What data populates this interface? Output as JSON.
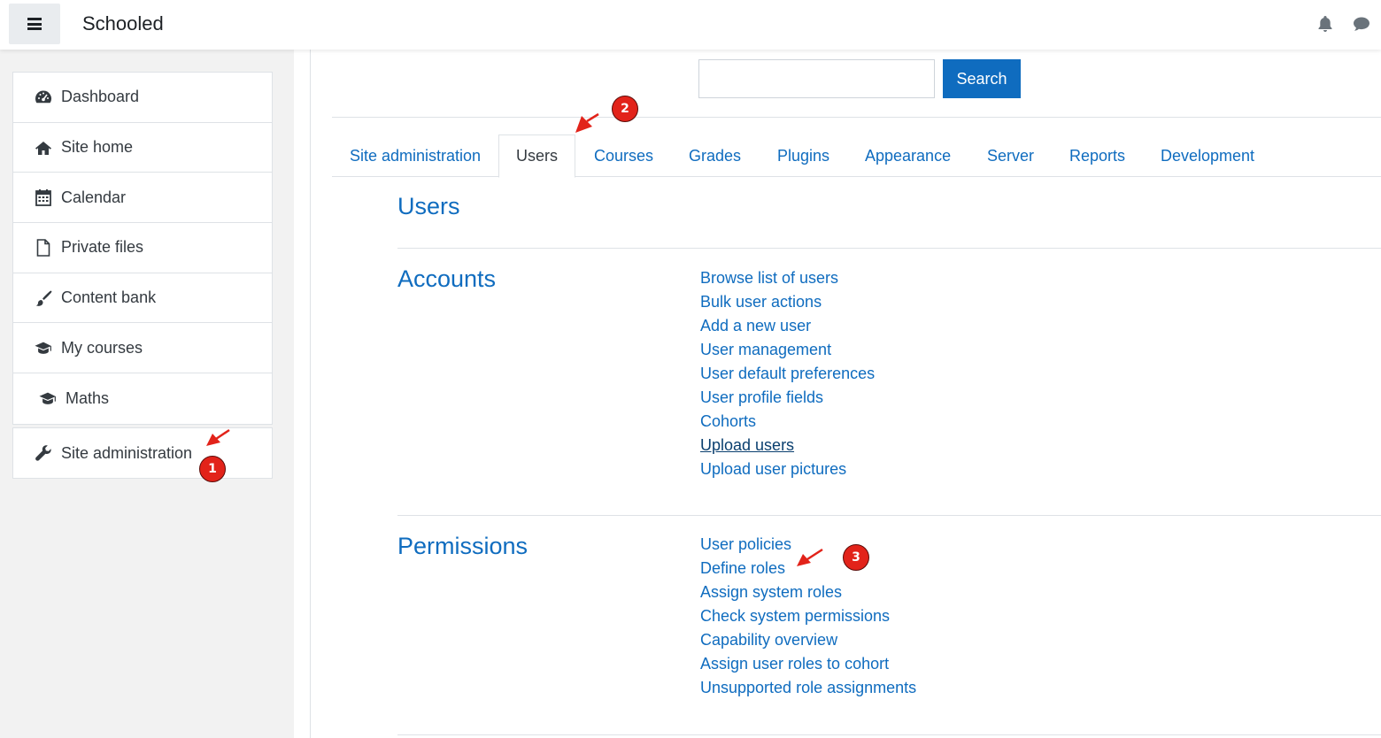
{
  "header": {
    "site_name": "Schooled",
    "menu_icon": "hamburger-icon",
    "notification_icon": "bell-icon",
    "messages_icon": "chat-bubble-icon"
  },
  "sidebar": {
    "items": [
      {
        "label": "Dashboard",
        "icon": "dashboard-gauge-icon"
      },
      {
        "label": "Site home",
        "icon": "home-icon"
      },
      {
        "label": "Calendar",
        "icon": "calendar-icon"
      },
      {
        "label": "Private files",
        "icon": "file-icon"
      },
      {
        "label": "Content bank",
        "icon": "paintbrush-icon"
      },
      {
        "label": "My courses",
        "icon": "graduation-cap-icon"
      },
      {
        "label": "Maths",
        "icon": "graduation-cap-icon"
      }
    ],
    "admin": {
      "label": "Site administration",
      "icon": "wrench-icon"
    }
  },
  "search": {
    "value": "",
    "button_label": "Search"
  },
  "tabs": [
    {
      "label": "Site administration"
    },
    {
      "label": "Users",
      "active": true
    },
    {
      "label": "Courses"
    },
    {
      "label": "Grades"
    },
    {
      "label": "Plugins"
    },
    {
      "label": "Appearance"
    },
    {
      "label": "Server"
    },
    {
      "label": "Reports"
    },
    {
      "label": "Development"
    }
  ],
  "page_heading": "Users",
  "sections": [
    {
      "title": "Accounts",
      "links": [
        "Browse list of users",
        "Bulk user actions",
        "Add a new user",
        "User management",
        "User default preferences",
        "User profile fields",
        "Cohorts",
        "Upload users",
        "Upload user pictures"
      ]
    },
    {
      "title": "Permissions",
      "links": [
        "User policies",
        "Define roles",
        "Assign system roles",
        "Check system permissions",
        "Capability overview",
        "Assign user roles to cohort",
        "Unsupported role assignments"
      ]
    }
  ],
  "annotations": {
    "badge_1": "1",
    "badge_2": "2",
    "badge_3": "3",
    "color": "#e2231a"
  },
  "colors": {
    "link": "#0f6cbf",
    "button": "#0f6cbf",
    "drawer_bg": "#f2f2f2"
  }
}
